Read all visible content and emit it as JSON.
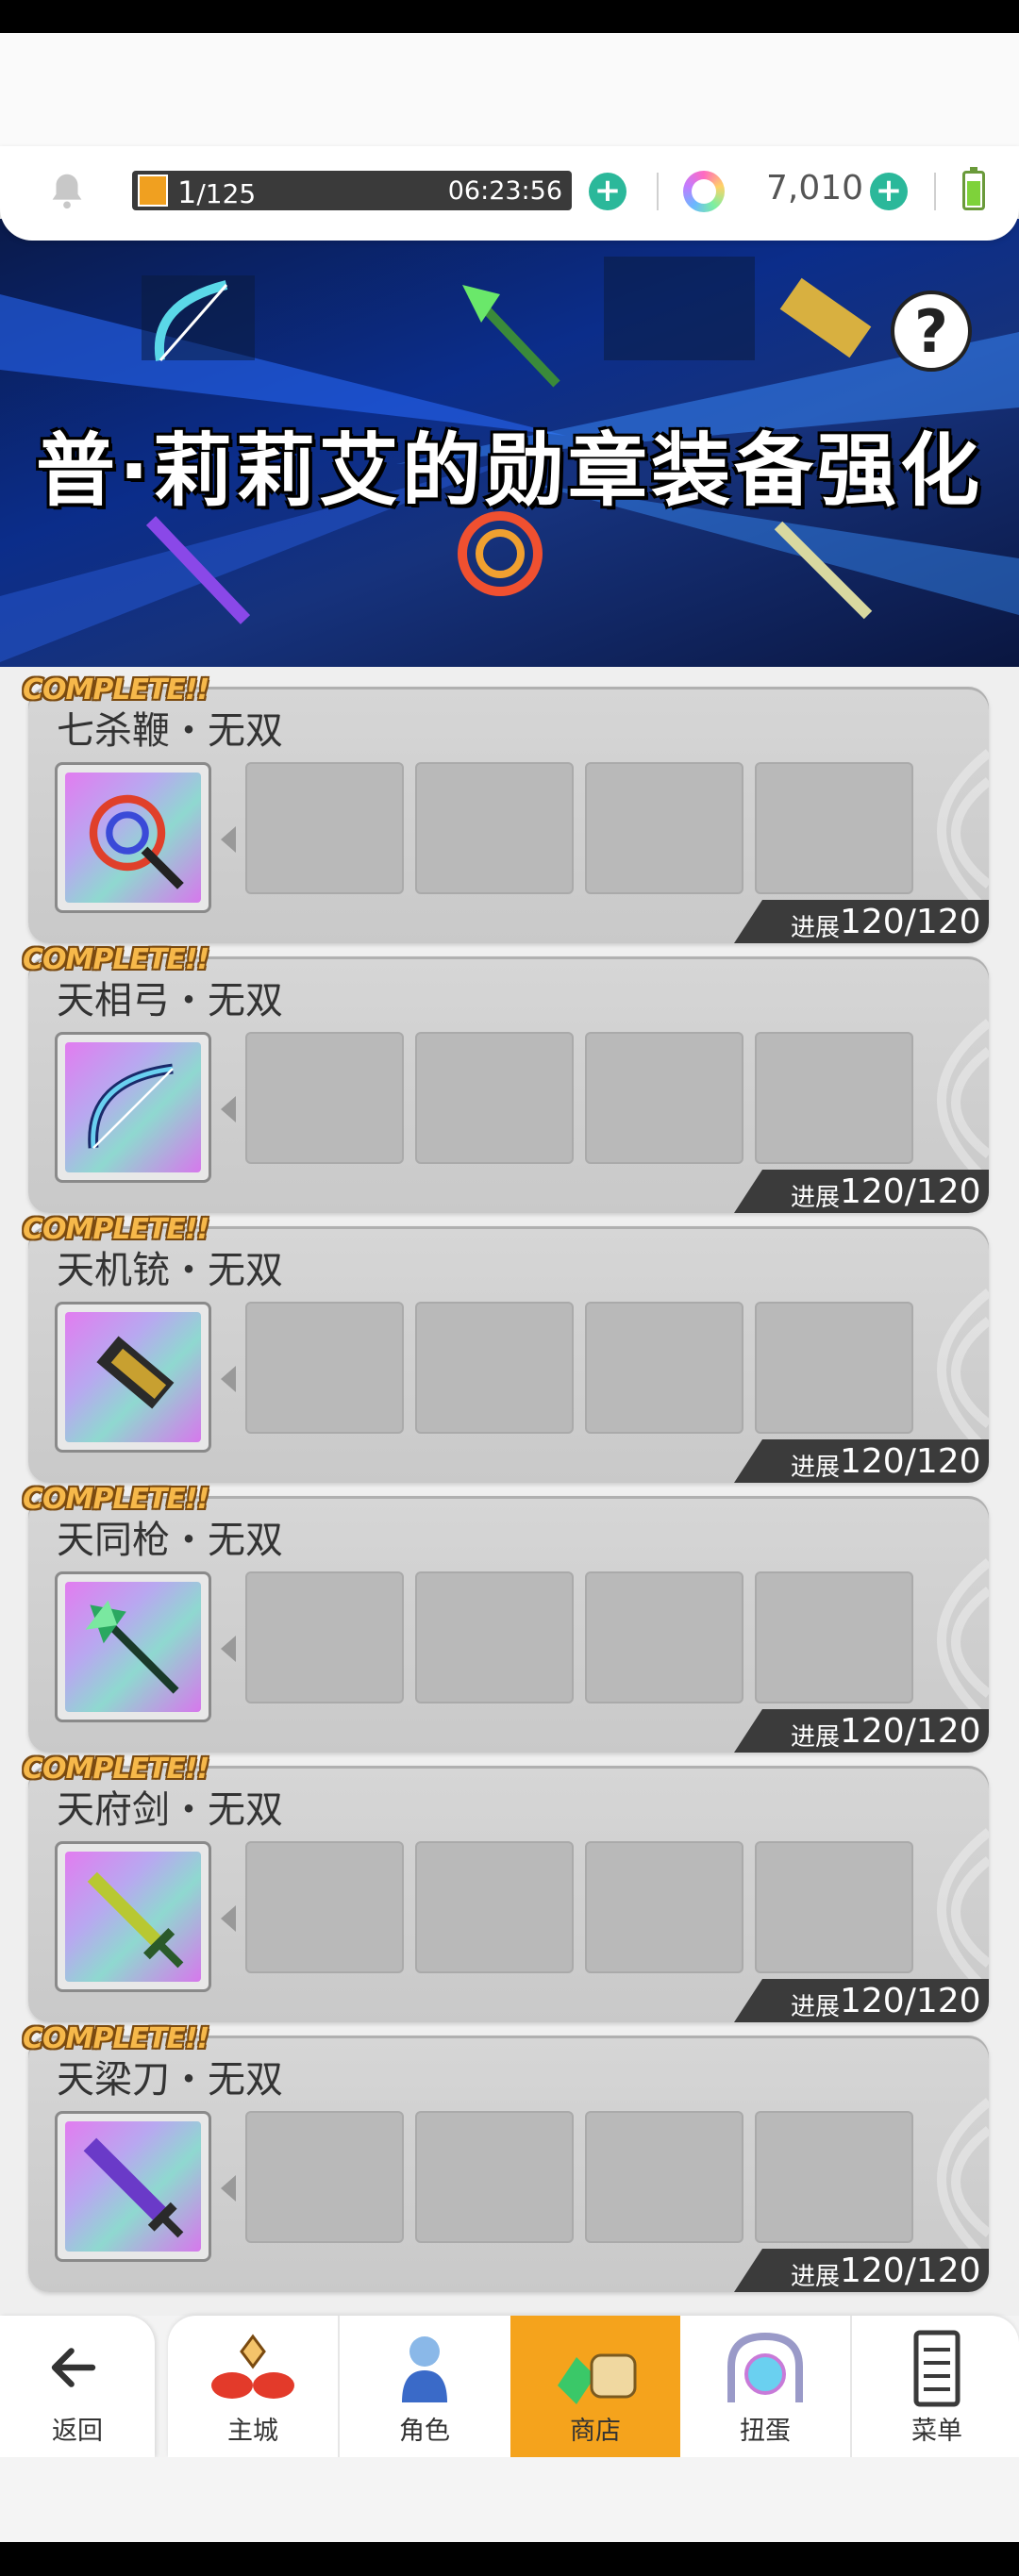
{
  "header": {
    "stamina_current": "1",
    "stamina_max": "/125",
    "stamina_timer": "06:23:56",
    "gem_count": "7,010"
  },
  "banner": {
    "title": "普·莉莉艾的勋章装备强化",
    "help": "?"
  },
  "equipment": [
    {
      "badge": "COMPLETE!!",
      "name": "七杀鞭・无双",
      "progress_label": "进展",
      "progress": "120/120",
      "icon": "whip-icon",
      "color": "#e0402a"
    },
    {
      "badge": "COMPLETE!!",
      "name": "天相弓・无双",
      "progress_label": "进展",
      "progress": "120/120",
      "icon": "bow-icon",
      "color": "#3a7ad8"
    },
    {
      "badge": "COMPLETE!!",
      "name": "天机铳・无双",
      "progress_label": "进展",
      "progress": "120/120",
      "icon": "gun-icon",
      "color": "#c8a030"
    },
    {
      "badge": "COMPLETE!!",
      "name": "天同枪・无双",
      "progress_label": "进展",
      "progress": "120/120",
      "icon": "spear-icon",
      "color": "#2aa860"
    },
    {
      "badge": "COMPLETE!!",
      "name": "天府剑・无双",
      "progress_label": "进展",
      "progress": "120/120",
      "icon": "sword-icon",
      "color": "#b8c832"
    },
    {
      "badge": "COMPLETE!!",
      "name": "天梁刀・无双",
      "progress_label": "进展",
      "progress": "120/120",
      "icon": "blade-icon",
      "color": "#6a3ac8"
    }
  ],
  "nav": {
    "back": "返回",
    "items": [
      "主城",
      "角色",
      "商店",
      "扭蛋",
      "菜单"
    ],
    "active": "商店"
  },
  "colors": {
    "accent": "#f5a31c",
    "plus": "#2bb89a",
    "badge": "#f6b84a"
  }
}
